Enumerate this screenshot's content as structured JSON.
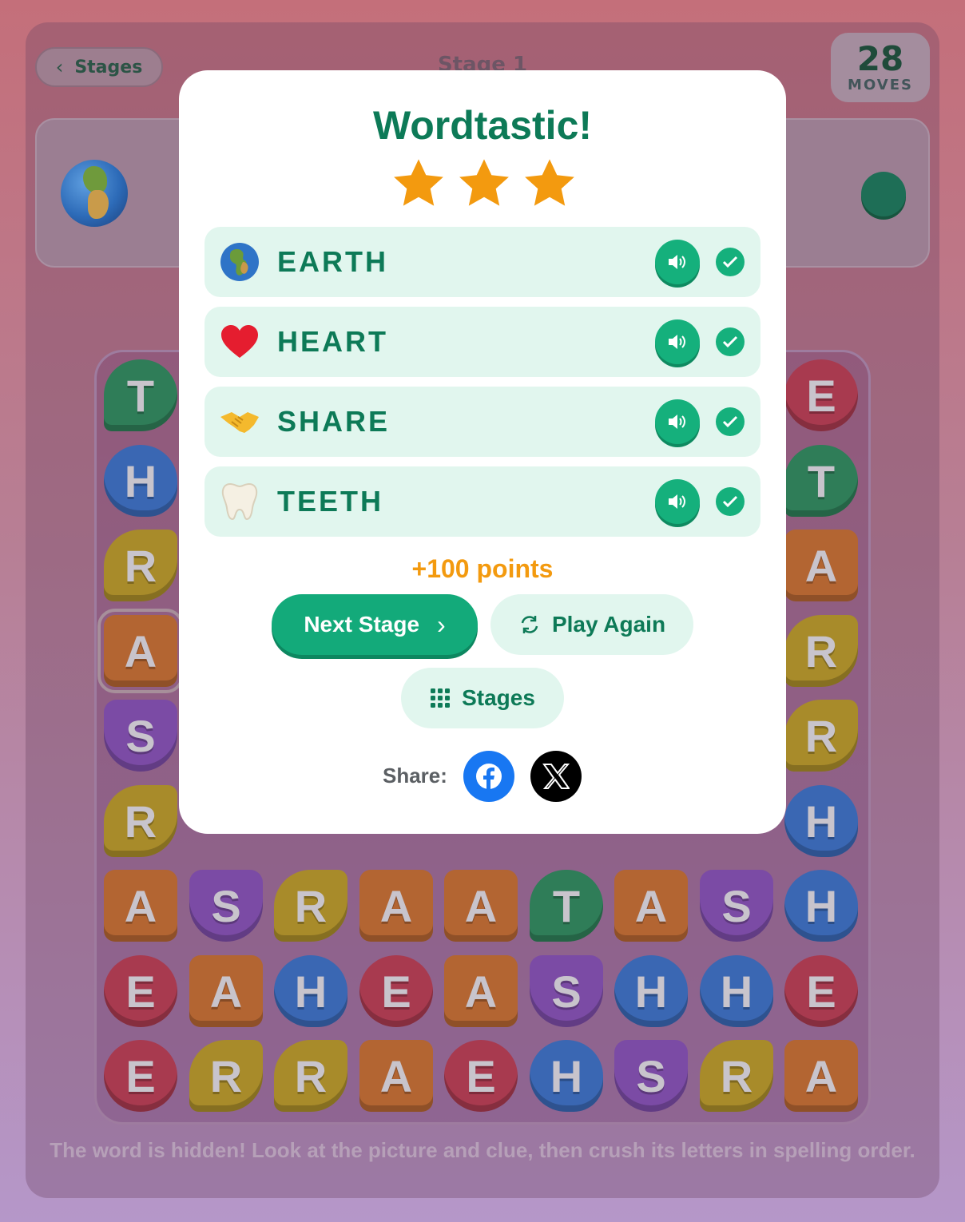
{
  "header": {
    "back_label": "Stages",
    "stage_title": "Stage 1",
    "moves_count": "28",
    "moves_label": "MOVES"
  },
  "board": {
    "rows": [
      [
        "T",
        "",
        "",
        "",
        "",
        "",
        "",
        "",
        "E"
      ],
      [
        "H",
        "",
        "",
        "",
        "",
        "",
        "",
        "",
        "T"
      ],
      [
        "R",
        "",
        "",
        "",
        "",
        "",
        "",
        "",
        "A"
      ],
      [
        "A",
        "",
        "",
        "",
        "",
        "",
        "",
        "",
        "R"
      ],
      [
        "S",
        "",
        "",
        "",
        "",
        "",
        "",
        "",
        "R"
      ],
      [
        "R",
        "",
        "",
        "",
        "",
        "",
        "",
        "",
        "H"
      ],
      [
        "A",
        "S",
        "R",
        "A",
        "A",
        "T",
        "A",
        "S",
        "H"
      ],
      [
        "E",
        "A",
        "H",
        "E",
        "A",
        "S",
        "H",
        "H",
        "E"
      ],
      [
        "E",
        "R",
        "R",
        "A",
        "E",
        "H",
        "S",
        "R",
        "A"
      ]
    ]
  },
  "hint": "The word is hidden! Look at the picture and clue, then crush its letters in spelling order.",
  "modal": {
    "title": "Wordtastic!",
    "stars_earned": 3,
    "stars_total": 3,
    "words": [
      {
        "text": "EARTH",
        "emoji": "earth-globe-icon"
      },
      {
        "text": "HEART",
        "emoji": "red-heart-icon"
      },
      {
        "text": "SHARE",
        "emoji": "handshake-icon"
      },
      {
        "text": "TEETH",
        "emoji": "tooth-icon"
      }
    ],
    "points": "+100 points",
    "next_label": "Next Stage",
    "play_again_label": "Play Again",
    "stages_label": "Stages",
    "share_label": "Share:"
  },
  "colors": {
    "accent": "#13aa7a",
    "title": "#0d7a57",
    "star": "#f39a0f",
    "row_bg": "#e1f6ee",
    "facebook": "#1877f2"
  }
}
